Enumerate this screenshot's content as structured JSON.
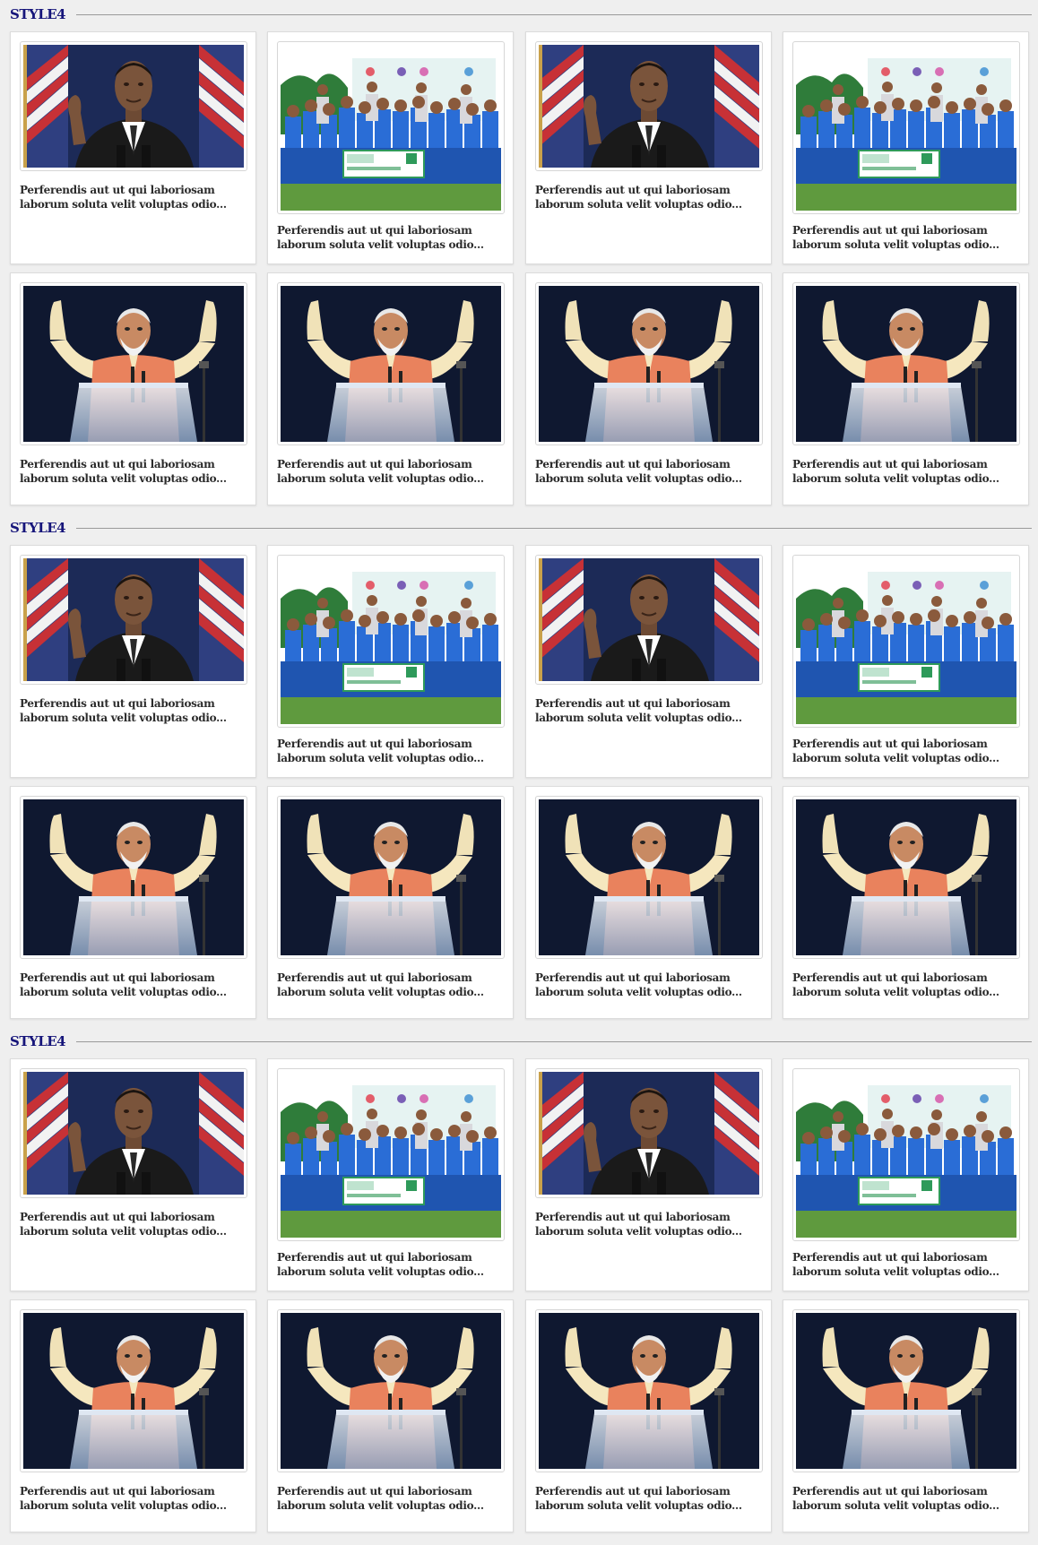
{
  "sections": [
    {
      "title": "STYLE4",
      "cards": [
        {
          "image": "obama-speech-photo",
          "caption": "Perferendis aut ut qui laboriosam laborum soluta velit voluptas odio..."
        },
        {
          "image": "cricket-team-photo",
          "caption": "Perferendis aut ut qui laboriosam laborum soluta velit voluptas odio..."
        },
        {
          "image": "obama-speech-photo",
          "caption": "Perferendis aut ut qui laboriosam laborum soluta velit voluptas odio..."
        },
        {
          "image": "cricket-team-photo",
          "caption": "Perferendis aut ut qui laboriosam laborum soluta velit voluptas odio..."
        },
        {
          "image": "modi-podium-photo",
          "caption": "Perferendis aut ut qui laboriosam laborum soluta velit voluptas odio..."
        },
        {
          "image": "modi-podium-photo",
          "caption": "Perferendis aut ut qui laboriosam laborum soluta velit voluptas odio..."
        },
        {
          "image": "modi-podium-photo",
          "caption": "Perferendis aut ut qui laboriosam laborum soluta velit voluptas odio..."
        },
        {
          "image": "modi-podium-photo",
          "caption": "Perferendis aut ut qui laboriosam laborum soluta velit voluptas odio..."
        }
      ]
    },
    {
      "title": "STYLE4",
      "cards": [
        {
          "image": "obama-speech-photo",
          "caption": "Perferendis aut ut qui laboriosam laborum soluta velit voluptas odio..."
        },
        {
          "image": "cricket-team-photo",
          "caption": "Perferendis aut ut qui laboriosam laborum soluta velit voluptas odio..."
        },
        {
          "image": "obama-speech-photo",
          "caption": "Perferendis aut ut qui laboriosam laborum soluta velit voluptas odio..."
        },
        {
          "image": "cricket-team-photo",
          "caption": "Perferendis aut ut qui laboriosam laborum soluta velit voluptas odio..."
        },
        {
          "image": "modi-podium-photo",
          "caption": "Perferendis aut ut qui laboriosam laborum soluta velit voluptas odio..."
        },
        {
          "image": "modi-podium-photo",
          "caption": "Perferendis aut ut qui laboriosam laborum soluta velit voluptas odio..."
        },
        {
          "image": "modi-podium-photo",
          "caption": "Perferendis aut ut qui laboriosam laborum soluta velit voluptas odio..."
        },
        {
          "image": "modi-podium-photo",
          "caption": "Perferendis aut ut qui laboriosam laborum soluta velit voluptas odio..."
        }
      ]
    },
    {
      "title": "STYLE4",
      "cards": [
        {
          "image": "obama-speech-photo",
          "caption": "Perferendis aut ut qui laboriosam laborum soluta velit voluptas odio..."
        },
        {
          "image": "cricket-team-photo",
          "caption": "Perferendis aut ut qui laboriosam laborum soluta velit voluptas odio..."
        },
        {
          "image": "obama-speech-photo",
          "caption": "Perferendis aut ut qui laboriosam laborum soluta velit voluptas odio..."
        },
        {
          "image": "cricket-team-photo",
          "caption": "Perferendis aut ut qui laboriosam laborum soluta velit voluptas odio..."
        },
        {
          "image": "modi-podium-photo",
          "caption": "Perferendis aut ut qui laboriosam laborum soluta velit voluptas odio..."
        },
        {
          "image": "modi-podium-photo",
          "caption": "Perferendis aut ut qui laboriosam laborum soluta velit voluptas odio..."
        },
        {
          "image": "modi-podium-photo",
          "caption": "Perferendis aut ut qui laboriosam laborum soluta velit voluptas odio..."
        },
        {
          "image": "modi-podium-photo",
          "caption": "Perferendis aut ut qui laboriosam laborum soluta velit voluptas odio..."
        }
      ]
    }
  ],
  "colors": {
    "title": "#16157a",
    "background": "#efefef",
    "card": "#ffffff"
  }
}
